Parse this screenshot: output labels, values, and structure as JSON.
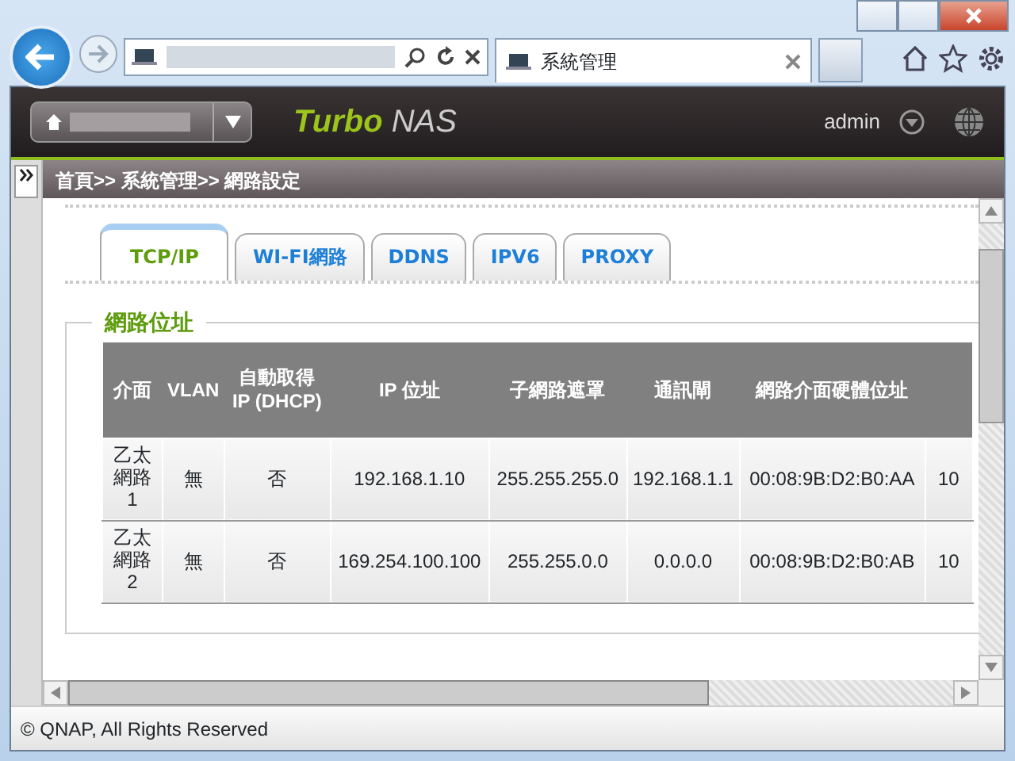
{
  "browser": {
    "tab_title": "系統管理"
  },
  "header": {
    "logo_bold": "Turbo",
    "logo_rest": "NAS",
    "user": "admin"
  },
  "breadcrumb": "首頁>> 系統管理>> 網路設定",
  "tabs": [
    {
      "label": "TCP/IP",
      "selected": true
    },
    {
      "label": "WI-FI網路",
      "selected": false
    },
    {
      "label": "DDNS",
      "selected": false
    },
    {
      "label": "IPV6",
      "selected": false
    },
    {
      "label": "PROXY",
      "selected": false
    }
  ],
  "section": {
    "title": "網路位址"
  },
  "table": {
    "columns": [
      "介面",
      "VLAN",
      "自動取得 IP (DHCP)",
      "IP 位址",
      "子網路遮罩",
      "通訊閘",
      "網路介面硬體位址"
    ],
    "rows": [
      [
        "乙太網路 1",
        "無",
        "否",
        "192.168.1.10",
        "255.255.255.0",
        "192.168.1.1",
        "00:08:9B:D2:B0:AA",
        "10"
      ],
      [
        "乙太網路 2",
        "無",
        "否",
        "169.254.100.100",
        "255.255.0.0",
        "0.0.0.0",
        "00:08:9B:D2:B0:AB",
        "10"
      ]
    ]
  },
  "footer": "© QNAP, All Rights Reserved"
}
